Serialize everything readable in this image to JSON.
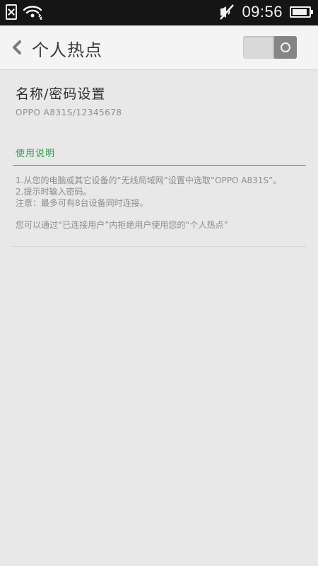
{
  "status_bar": {
    "time": "09:56",
    "icons": [
      "sim-error-icon",
      "wifi-hotspot-icon",
      "mute-icon",
      "battery-icon"
    ],
    "battery_level": 0.92
  },
  "header": {
    "title": "个人热点",
    "back_icon": "back-chevron-icon",
    "hotspot_enabled": true
  },
  "settings": {
    "name_password": {
      "title": "名称/密码设置",
      "value": "OPPO A831S/12345678"
    }
  },
  "instructions": {
    "header": "使用说明",
    "lines": [
      "1.从您的电脑或其它设备的“无线局域网”设置中选取“OPPO A831S”。",
      "2.提示时输入密码。",
      "注意：最多可有8台设备同时连接。"
    ],
    "tip": "您可以通过“已连接用户”内拒绝用户使用您的“个人热点”"
  },
  "colors": {
    "status_bar_bg": "#151515",
    "background": "#e8e8e8",
    "accent_green": "#27a04f"
  }
}
